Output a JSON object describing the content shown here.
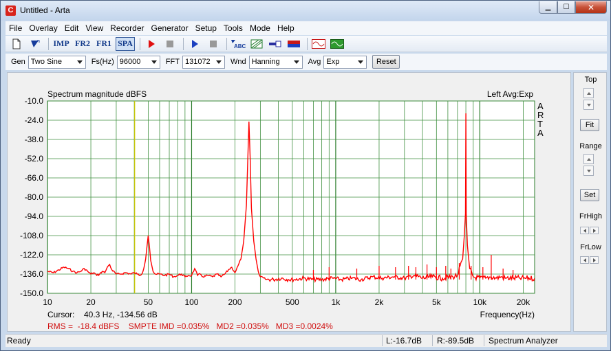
{
  "window": {
    "title": "Untitled - Arta",
    "app_icon_letter": "C"
  },
  "menu": [
    "File",
    "Overlay",
    "Edit",
    "View",
    "Recorder",
    "Generator",
    "Setup",
    "Tools",
    "Mode",
    "Help"
  ],
  "toolbar": {
    "imp_label": "IMP",
    "fr2_label": "FR2",
    "fr1_label": "FR1",
    "spa_label": "SPA",
    "tooltip_abc": "ABC"
  },
  "controls": {
    "gen_label": "Gen",
    "gen_value": "Two Sine",
    "fs_label": "Fs(Hz)",
    "fs_value": "96000",
    "fft_label": "FFT",
    "fft_value": "131072",
    "wnd_label": "Wnd",
    "wnd_value": "Hanning",
    "avg_label": "Avg",
    "avg_value": "Exp",
    "reset_label": "Reset"
  },
  "right_panel": {
    "top_label": "Top",
    "fit_label": "Fit",
    "range_label": "Range",
    "set_label": "Set",
    "frhigh_label": "FrHigh",
    "frlow_label": "FrLow"
  },
  "chart_data": {
    "type": "line",
    "title": "Spectrum magnitude dBFS",
    "channel_label": "Left  Avg:Exp",
    "watermark": "ARTA",
    "xlabel": "Frequency(Hz)",
    "x_scale": "log",
    "xlim": [
      10,
      24000
    ],
    "ylim": [
      -150,
      -10
    ],
    "x_tick_labels": [
      "10",
      "20",
      "50",
      "100",
      "200",
      "500",
      "1k",
      "2k",
      "5k",
      "10k",
      "20k"
    ],
    "x_tick_values": [
      10,
      20,
      50,
      100,
      200,
      500,
      1000,
      2000,
      5000,
      10000,
      20000
    ],
    "y_tick_labels": [
      "-10.0",
      "-24.0",
      "-38.0",
      "-52.0",
      "-66.0",
      "-80.0",
      "-94.0",
      "-108.0",
      "-122.0",
      "-136.0",
      "-150.0"
    ],
    "y_tick_values": [
      -10,
      -24,
      -38,
      -52,
      -66,
      -80,
      -94,
      -108,
      -122,
      -136,
      -150
    ],
    "grid": true,
    "cursor": {
      "label": "Cursor:",
      "value": "40.3 Hz, -134.56 dB",
      "frequency": 40.3
    },
    "series": [
      {
        "color": "#ff0000",
        "points": [
          [
            10,
            -134
          ],
          [
            11,
            -135
          ],
          [
            12,
            -133
          ],
          [
            13,
            -131
          ],
          [
            14,
            -132
          ],
          [
            15,
            -134
          ],
          [
            16,
            -135
          ],
          [
            17,
            -134
          ],
          [
            18,
            -132
          ],
          [
            19,
            -134
          ],
          [
            20,
            -136
          ],
          [
            21,
            -135
          ],
          [
            22,
            -137
          ],
          [
            23,
            -136
          ],
          [
            24,
            -134
          ],
          [
            25,
            -135
          ],
          [
            26,
            -131
          ],
          [
            27,
            -129
          ],
          [
            28,
            -133
          ],
          [
            30,
            -136
          ],
          [
            32,
            -136
          ],
          [
            35,
            -135
          ],
          [
            38,
            -136
          ],
          [
            40,
            -135
          ],
          [
            42,
            -136
          ],
          [
            44,
            -137
          ],
          [
            46,
            -134
          ],
          [
            48,
            -125
          ],
          [
            49,
            -116
          ],
          [
            50,
            -108
          ],
          [
            51,
            -116
          ],
          [
            52,
            -126
          ],
          [
            54,
            -134
          ],
          [
            56,
            -136
          ],
          [
            60,
            -136
          ],
          [
            65,
            -137
          ],
          [
            70,
            -136
          ],
          [
            75,
            -138
          ],
          [
            80,
            -137
          ],
          [
            85,
            -136
          ],
          [
            90,
            -138
          ],
          [
            95,
            -137
          ],
          [
            100,
            -137
          ],
          [
            105,
            -132
          ],
          [
            110,
            -137
          ],
          [
            115,
            -136
          ],
          [
            120,
            -138
          ],
          [
            130,
            -137
          ],
          [
            140,
            -138
          ],
          [
            150,
            -136
          ],
          [
            160,
            -138
          ],
          [
            170,
            -136
          ],
          [
            180,
            -133
          ],
          [
            190,
            -131
          ],
          [
            200,
            -135
          ],
          [
            210,
            -130
          ],
          [
            220,
            -125
          ],
          [
            230,
            -112
          ],
          [
            240,
            -86
          ],
          [
            245,
            -55
          ],
          [
            250,
            -25
          ],
          [
            255,
            -52
          ],
          [
            260,
            -88
          ],
          [
            270,
            -112
          ],
          [
            280,
            -125
          ],
          [
            290,
            -134
          ],
          [
            300,
            -138
          ],
          [
            330,
            -140
          ],
          [
            370,
            -140
          ],
          [
            420,
            -139
          ],
          [
            470,
            -140
          ],
          [
            520,
            -140
          ],
          [
            600,
            -139
          ],
          [
            700,
            -140
          ],
          [
            800,
            -140
          ],
          [
            950,
            -139
          ],
          [
            1100,
            -140
          ],
          [
            1300,
            -139
          ],
          [
            1500,
            -140
          ],
          [
            1800,
            -138
          ],
          [
            2100,
            -139
          ],
          [
            2500,
            -138
          ],
          [
            3000,
            -139
          ],
          [
            3500,
            -137
          ],
          [
            4000,
            -139
          ],
          [
            4700,
            -138
          ],
          [
            5500,
            -139
          ],
          [
            6500,
            -138
          ],
          [
            7000,
            -137
          ],
          [
            7600,
            -125
          ],
          [
            7800,
            -108
          ],
          [
            7950,
            -92
          ],
          [
            8000,
            -19
          ],
          [
            8050,
            -92
          ],
          [
            8200,
            -115
          ],
          [
            8500,
            -132
          ],
          [
            9000,
            -138
          ],
          [
            10000,
            -139
          ],
          [
            11000,
            -139
          ],
          [
            12000,
            -138
          ],
          [
            13000,
            -139
          ],
          [
            14000,
            -138
          ],
          [
            15000,
            -139
          ],
          [
            17000,
            -139
          ],
          [
            19000,
            -139
          ],
          [
            21000,
            -139
          ],
          [
            24000,
            -139
          ]
        ]
      }
    ],
    "noise_spikes": [
      [
        700,
        -133
      ],
      [
        900,
        -131
      ],
      [
        1400,
        -132
      ],
      [
        2000,
        -130
      ],
      [
        2600,
        -131
      ],
      [
        3200,
        -130
      ],
      [
        3600,
        -131
      ],
      [
        4300,
        -129
      ],
      [
        5000,
        -131
      ],
      [
        5800,
        -130
      ],
      [
        6300,
        -132
      ],
      [
        7200,
        -128
      ],
      [
        8700,
        -130
      ],
      [
        10500,
        -131
      ],
      [
        12000,
        -122
      ],
      [
        14500,
        -132
      ],
      [
        17000,
        -133
      ]
    ]
  },
  "measurements": "RMS =  -18.4 dBFS    SMPTE IMD =0.035%   MD2 =0.035%   MD3 =0.0024%",
  "status": {
    "ready": "Ready",
    "left_level": "L:-16.7dB",
    "right_level": "R:-89.5dB",
    "mode": "Spectrum Analyzer"
  }
}
